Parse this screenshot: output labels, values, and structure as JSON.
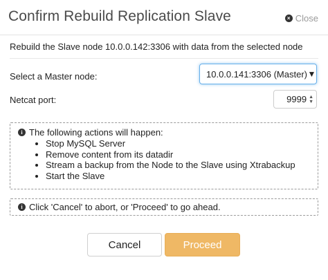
{
  "dialog": {
    "title": "Confirm Rebuild Replication Slave",
    "close_label": "Close",
    "description": "Rebuild the Slave node 10.0.0.142:3306 with data from the selected node"
  },
  "form": {
    "master_label": "Select a Master node:",
    "master_value": "10.0.0.141:3306 (Master)",
    "netcat_label": "Netcat port:",
    "netcat_value": "9999"
  },
  "info": {
    "heading": "The following actions will happen:",
    "items": [
      "Stop MySQL Server",
      "Remove content from its datadir",
      "Stream a backup from the Node to the Slave using Xtrabackup",
      "Start the Slave"
    ]
  },
  "note": {
    "text": "Click 'Cancel' to abort, or 'Proceed' to go ahead."
  },
  "buttons": {
    "cancel": "Cancel",
    "proceed": "Proceed"
  },
  "icons": {
    "close": "close-circle-icon",
    "info": "info-circle-icon",
    "dropdown": "caret-down-icon",
    "spinner": "spin-arrows-icon"
  },
  "colors": {
    "proceed_bg": "#efb865",
    "focus_border": "#66afe9"
  }
}
